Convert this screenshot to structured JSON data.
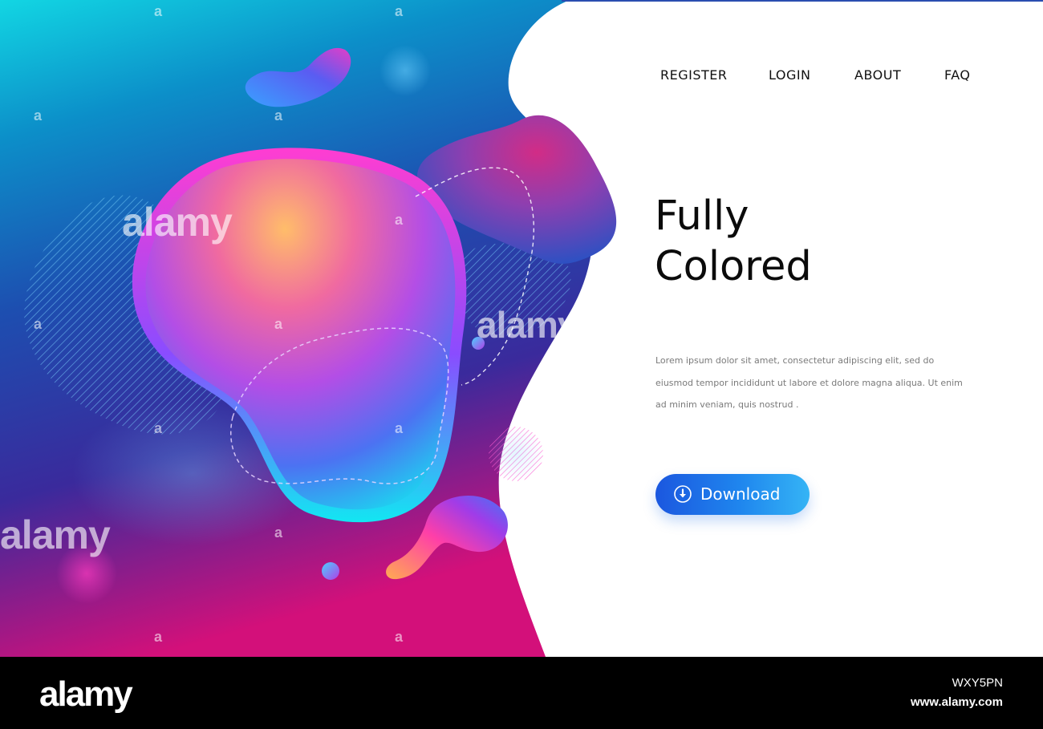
{
  "nav": {
    "items": [
      "REGISTER",
      "LOGIN",
      "ABOUT",
      "FAQ"
    ]
  },
  "hero": {
    "title_line1": "Fully",
    "title_line2": "Colored",
    "body": "Lorem ipsum dolor sit amet, consectetur adipiscing elit, sed do eiusmod tempor incididunt ut labore et dolore magna aliqua. Ut enim ad minim veniam, quis nostrud .",
    "download_label": "Download",
    "download_icon": "download-arrow-icon"
  },
  "watermark": {
    "brand": "alamy",
    "letter": "a"
  },
  "footer": {
    "logo": "alamy",
    "image_id": "WXY5PN",
    "url": "www.alamy.com"
  },
  "colors": {
    "accent_blue": "#1b6fe6",
    "gradient_top": "#12cde0",
    "gradient_mid": "#2a3fae",
    "gradient_bottom": "#d0127c"
  }
}
